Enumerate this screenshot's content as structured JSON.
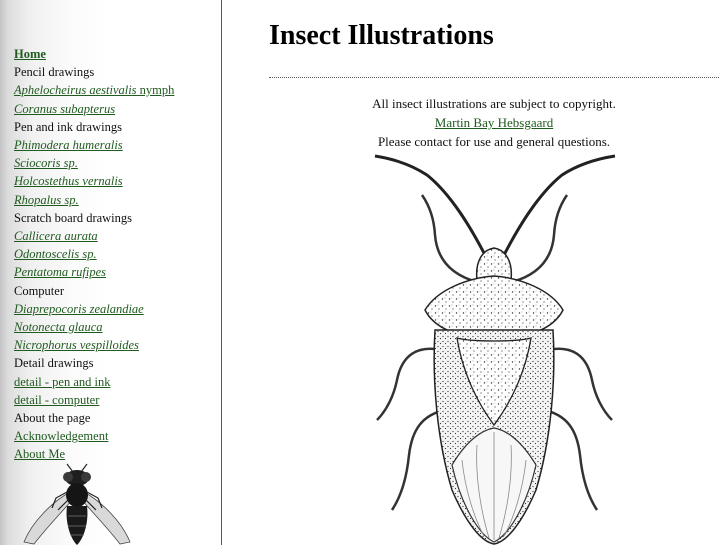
{
  "nav": {
    "home": "Home",
    "pencil_heading": "Pencil drawings",
    "aphelocheirus_italic": "Aphelocheirus aestivalis",
    "aphelocheirus_suffix": " nymph",
    "coranus": "Coranus subapterus",
    "pen_heading": "Pen and ink drawings",
    "phimodera": "Phimodera humeralis",
    "sciocoris": "Sciocoris sp.",
    "holcostethus": "Holcostethus vernalis",
    "rhopalus": "Rhopalus sp.",
    "scratch_heading": "Scratch board drawings",
    "callicera": "Callicera aurata",
    "odontoscelis": "Odontoscelis sp.",
    "pentatoma": "Pentatoma rufipes",
    "computer_heading": "Computer",
    "diaprepocoris": "Diaprepocoris zealandiae",
    "notonecta": "Notonecta glauca",
    "nicrophorus": "Nicrophorus vespilloides",
    "detail_heading": "Detail drawings",
    "detail_pen": "detail - pen and ink",
    "detail_computer": "detail - computer",
    "about_heading": "About the page",
    "acknowledgement": "Acknowledgement",
    "about_me": "About Me"
  },
  "main": {
    "title": "Insect Illustrations",
    "copyright": "All insect illustrations are subject to copyright.",
    "author": "Martin Bay Hebsgaard",
    "contact": "Please contact for use and general questions."
  },
  "colors": {
    "link": "#1f5a1f",
    "divider": "#555555"
  },
  "icons": {
    "sidebar_image": "fly-illustration",
    "main_image": "shield-bug-illustration"
  }
}
